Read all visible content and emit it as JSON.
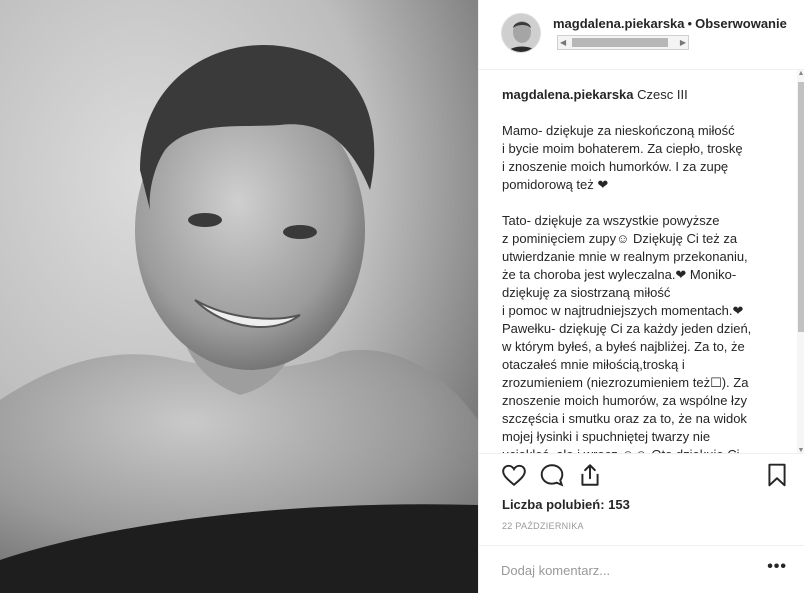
{
  "photo": {
    "icon": "portrait-photo"
  },
  "header": {
    "username": "magdalena.piekarska",
    "bullet": "•",
    "follow_label": "Obserwowanie",
    "avatar_icon": "profile-avatar"
  },
  "caption": {
    "username": "magdalena.piekarska",
    "title": "Czesc III",
    "paragraphs": [
      "Mamo- dziękuje za nieskończoną miłość\ni bycie moim bohaterem. Za ciepło, troskę\ni znoszenie moich humorków. I za zupę\npomidorową też ❤",
      "Tato- dziękuje za wszystkie powyższe\nz pominięciem zupy☺ Dziękuję Ci też za\nutwierdzanie mnie w realnym przekonaniu,\nże ta choroba jest wyleczalna.❤ Moniko-\ndziękuję za siostrzaną miłość\ni pomoc w najtrudniejszych momentach.❤\nPawełku- dziękuję Ci za każdy jeden dzień,\nw którym byłeś, a byłeś najbliżej. Za to, że\notaczałeś mnie miłością,troską i\nzrozumieniem (niezrozumieniem też☐). Za\nznoszenie moich humorów, za wspólne łzy\nszczęścia i smutku oraz za to, że na widok\nmojej łysinki i spuchniętej twarzy nie\nuciekłeś, ale i wręcz ☺☺ Oto dziękuję Ci"
    ]
  },
  "actions": {
    "like_icon": "heart-icon",
    "comment_icon": "comment-icon",
    "share_icon": "share-icon",
    "save_icon": "bookmark-icon"
  },
  "likes_text": "Liczba polubień: 153",
  "date_text": "22 PAŹDZIERNIKA",
  "comment": {
    "placeholder": "Dodaj komentarz...",
    "more_label": "•••"
  }
}
